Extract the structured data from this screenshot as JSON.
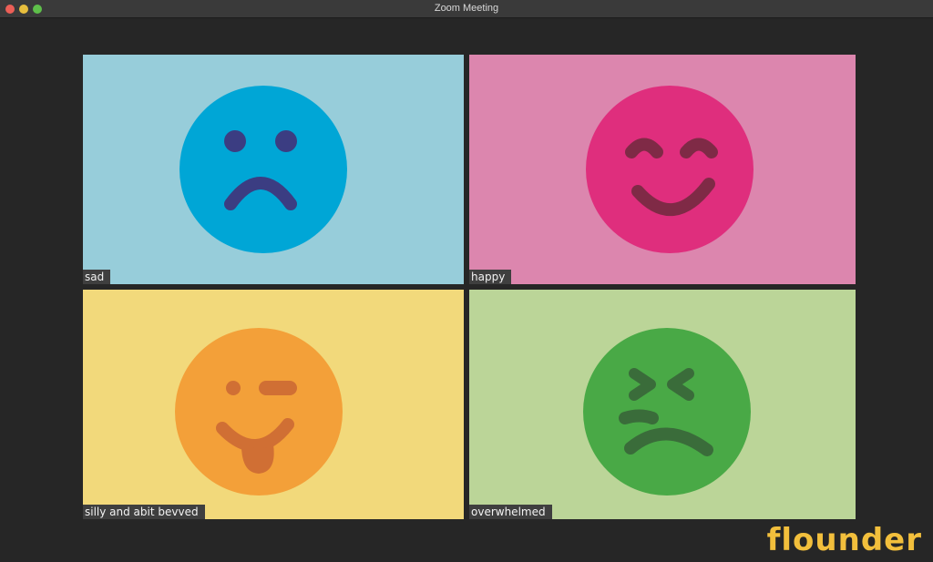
{
  "window": {
    "title": "Zoom Meeting"
  },
  "participants": [
    {
      "name": "sad",
      "face": "sad-face-icon",
      "tile_bg": "#97cdda",
      "face_color": "#00a6d6",
      "feature_color": "#3b3d82"
    },
    {
      "name": "happy",
      "face": "happy-face-icon",
      "tile_bg": "#dc86ae",
      "face_color": "#df2e7d",
      "feature_color": "#7f2a46"
    },
    {
      "name": "silly and abit bevved",
      "face": "silly-face-icon",
      "tile_bg": "#f2d97b",
      "face_color": "#f3a039",
      "feature_color": "#d06f34"
    },
    {
      "name": "overwhelmed",
      "face": "overwhelmed-face-icon",
      "tile_bg": "#bbd598",
      "face_color": "#49a946",
      "feature_color": "#3a6c3a"
    }
  ],
  "branding": {
    "logo_text": "flounder",
    "color": "#f2bf3c"
  }
}
